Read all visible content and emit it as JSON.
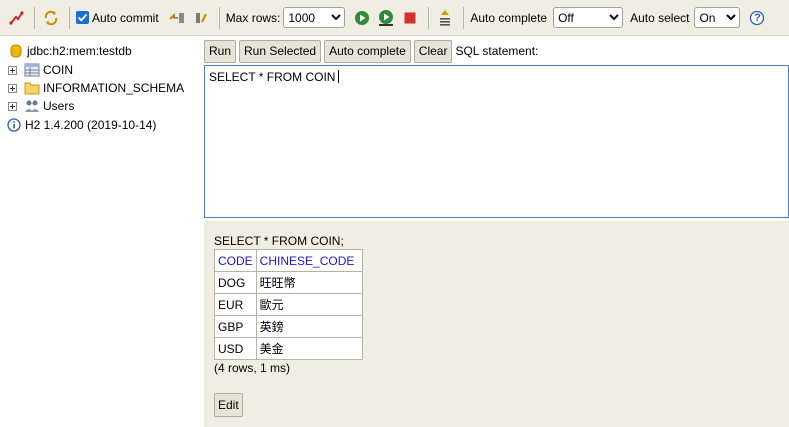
{
  "toolbar": {
    "auto_commit_label": "Auto commit",
    "max_rows_label": "Max rows:",
    "max_rows_value": "1000",
    "auto_complete_label": "Auto complete",
    "auto_complete_value": "Off",
    "auto_select_label": "Auto select",
    "auto_select_value": "On",
    "help_glyph": "?"
  },
  "tree": {
    "connection": "jdbc:h2:mem:testdb",
    "items": [
      {
        "label": "COIN",
        "icon": "table-icon"
      },
      {
        "label": "INFORMATION_SCHEMA",
        "icon": "folder-icon"
      },
      {
        "label": "Users",
        "icon": "users-icon"
      }
    ],
    "version": "H2 1.4.200 (2019-10-14)"
  },
  "query": {
    "run_label": "Run",
    "run_selected_label": "Run Selected",
    "auto_complete_label": "Auto complete",
    "clear_label": "Clear",
    "statement_label": "SQL statement:",
    "sql_text": "SELECT * FROM COIN"
  },
  "result": {
    "sql": "SELECT * FROM COIN;",
    "columns": [
      "CODE",
      "CHINESE_CODE"
    ],
    "rows": [
      [
        "DOG",
        "旺旺幣"
      ],
      [
        "EUR",
        "歐元"
      ],
      [
        "GBP",
        "英鎊"
      ],
      [
        "USD",
        "美金"
      ]
    ],
    "info": "(4 rows, 1 ms)",
    "edit_label": "Edit"
  },
  "colors": {
    "toolbar_bg": "#f0ede2",
    "result_bg": "#f0ede2",
    "header_text": "#1a1ad6",
    "sql_border": "#4a7fc4"
  }
}
